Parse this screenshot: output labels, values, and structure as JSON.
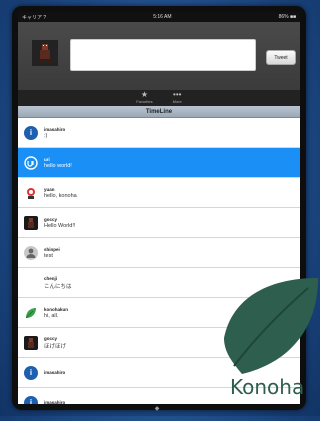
{
  "status": {
    "carrier": "キャリア ?",
    "time": "5:16 AM",
    "battery": "86% ■■"
  },
  "composer": {
    "tweet_label": "Tweet",
    "input_value": ""
  },
  "tabs": [
    {
      "label": "Favorites",
      "icon": "star-icon"
    },
    {
      "label": "More",
      "icon": "more-icon"
    }
  ],
  "timeline": {
    "title": "TimeLine",
    "items": [
      {
        "user": "imasahiro",
        "message": ":)",
        "avatar": "info-icon",
        "selected": false
      },
      {
        "user": "uri",
        "message": "hello world!",
        "avatar": "uri-logo-icon",
        "selected": true
      },
      {
        "user": "yuan",
        "message": "hello, konoha",
        "avatar": "character-icon",
        "selected": false
      },
      {
        "user": "goccy",
        "message": "Hello World!!",
        "avatar": "dark-avatar-icon",
        "selected": false
      },
      {
        "user": "shinpei",
        "message": "test",
        "avatar": "person-icon",
        "selected": false
      },
      {
        "user": "chenji",
        "message": "こんにちは",
        "avatar": "",
        "selected": false
      },
      {
        "user": "konohakun",
        "message": "hi, all.",
        "avatar": "leaf-icon",
        "selected": false
      },
      {
        "user": "goccy",
        "message": "ほげほげ",
        "avatar": "dark-avatar-icon",
        "selected": false
      },
      {
        "user": "imasahiro",
        "message": "",
        "avatar": "info-icon",
        "selected": false
      },
      {
        "user": "imasahiro",
        "message": "",
        "avatar": "info-icon",
        "selected": false
      }
    ]
  },
  "watermark": {
    "text": "Konoha",
    "color": "#2e5e4e"
  },
  "colors": {
    "selected_row": "#1a8ff5",
    "background": "#1d4a86"
  }
}
